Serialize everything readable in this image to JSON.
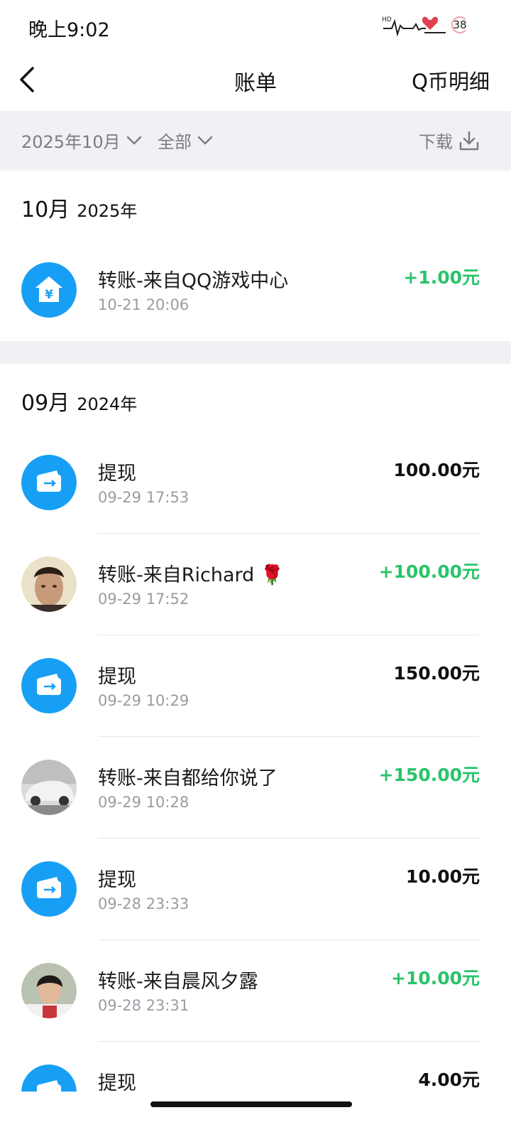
{
  "status": {
    "time": "晚上9:02",
    "battery": "38"
  },
  "nav": {
    "title": "账单",
    "right_label": "Q币明细"
  },
  "filters": {
    "month": "2025年10月",
    "type": "全部",
    "download": "下载"
  },
  "sections": [
    {
      "month": "10月",
      "year": "2025年",
      "rows": [
        {
          "title": "转账-来自QQ游戏中心",
          "time": "10-21 20:06",
          "amount": "+1.00元",
          "icon": "house-yuan-icon"
        }
      ]
    },
    {
      "month": "09月",
      "year": "2024年",
      "rows": [
        {
          "title": "提现",
          "time": "09-29 17:53",
          "amount": "100.00元",
          "icon": "card-withdraw-icon"
        },
        {
          "title": "转账-来自Richard 🌹",
          "time": "09-29 17:52",
          "amount": "+100.00元",
          "icon": "user-avatar"
        },
        {
          "title": "提现",
          "time": "09-29 10:29",
          "amount": "150.00元",
          "icon": "card-withdraw-icon"
        },
        {
          "title": "转账-来自都给你说了",
          "time": "09-29 10:28",
          "amount": "+150.00元",
          "icon": "car-avatar"
        },
        {
          "title": "提现",
          "time": "09-28 23:33",
          "amount": "10.00元",
          "icon": "card-withdraw-icon"
        },
        {
          "title": "转账-来自晨风夕露",
          "time": "09-28 23:31",
          "amount": "+10.00元",
          "icon": "user-avatar"
        },
        {
          "title": "提现",
          "time": "",
          "amount": "4.00元",
          "icon": "card-withdraw-icon"
        }
      ]
    }
  ],
  "colors": {
    "accent_blue": "#179ff5",
    "positive_green": "#29c46a",
    "band_gray": "#f1f1f5"
  }
}
